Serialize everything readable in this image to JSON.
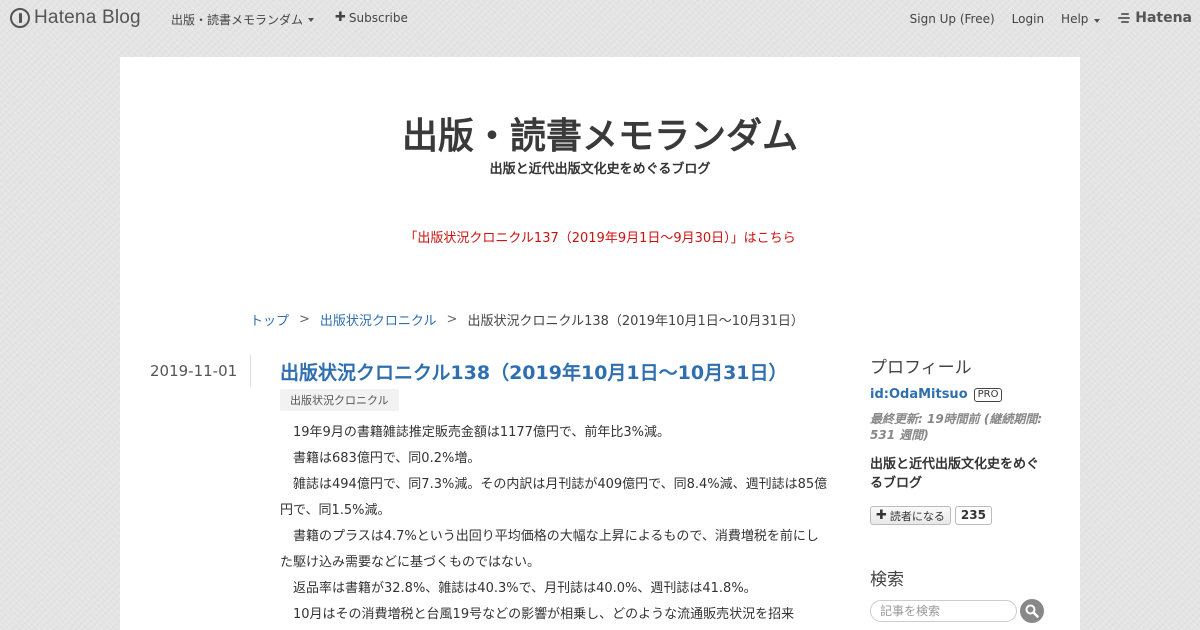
{
  "header": {
    "logo_text": "Hatena Blog",
    "blog_menu_label": "出版・読書メモランダム",
    "subscribe_label": "Subscribe",
    "signup_label": "Sign Up (Free)",
    "login_label": "Login",
    "help_label": "Help",
    "brand_label": "Hatena"
  },
  "blog": {
    "title": "出版・読書メモランダム",
    "description": "出版と近代出版文化史をめぐるブログ",
    "notice": "「出版状況クロニクル137（2019年9月1日～9月30日）」はこちら"
  },
  "breadcrumb": {
    "top": "トップ",
    "category": "出版状況クロニクル",
    "current": "出版状況クロニクル138（2019年10月1日～10月31日）",
    "separator": ">"
  },
  "entry": {
    "date": "2019-11-01",
    "title": "出版状況クロニクル138（2019年10月1日～10月31日）",
    "category": "出版状況クロニクル",
    "paragraphs": [
      "19年9月の書籍雑誌推定販売金額は1177億円で、前年比3%減。",
      "書籍は683億円で、同0.2%増。",
      "雑誌は494億円で、同7.3%減。その内訳は月刊誌が409億円で、同8.4%減、週刊誌は85億円で、同1.5%減。",
      "書籍のプラスは4.7%という出回り平均価格の大幅な上昇によるもので、消費増税を前にした駆け込み需要などに基づくものではない。",
      "返品率は書籍が32.8%、雑誌は40.3%で、月刊誌は40.0%、週刊誌は41.8%。",
      "10月はその消費増税と台風19号などの影響が相乗し、どのような流通販売状況を招来"
    ]
  },
  "sidebar": {
    "profile_heading": "プロフィール",
    "profile_id": "id:OdaMitsuo",
    "pro_badge": "PRO",
    "updated": "最終更新: 19時間前 (継続期間: 531 週間)",
    "description": "出版と近代出版文化史をめぐるブログ",
    "reader_button": "読者になる",
    "reader_count": "235",
    "search_heading": "検索",
    "search_placeholder": "記事を検索"
  },
  "colors": {
    "link": "#2f6fb0",
    "notice": "#cc1111",
    "background": "#e4e4e4"
  },
  "icons": {
    "logo": "hatena-blog-logo-icon",
    "subscribe": "plus-icon",
    "menu": "caret-down-icon",
    "search": "search-icon"
  }
}
